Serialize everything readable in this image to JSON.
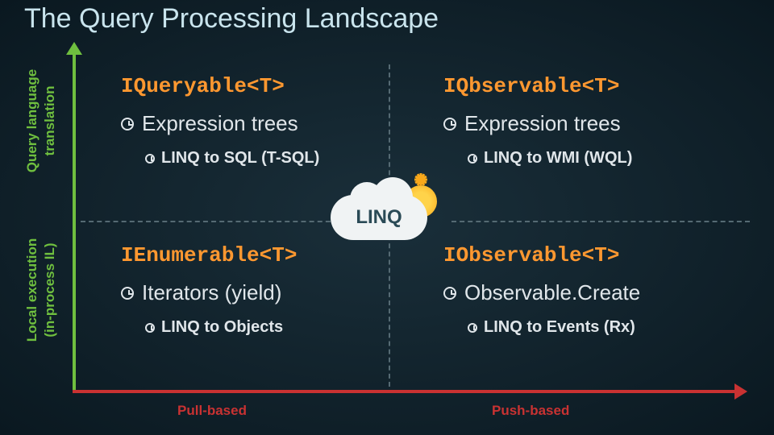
{
  "title": "The Query Processing Landscape",
  "axes": {
    "y": {
      "top": "Query language",
      "top2": "translation",
      "bottom": "Local execution",
      "bottom2": "(in-process IL)"
    },
    "x": {
      "left": "Pull-based",
      "right": "Push-based"
    }
  },
  "quadrants": {
    "tl": {
      "iface": "IQueryable<T>",
      "main": "Expression trees",
      "sub": "LINQ to SQL (T-SQL)"
    },
    "tr": {
      "iface": "IQbservable<T>",
      "main": "Expression trees",
      "sub": "LINQ to WMI (WQL)"
    },
    "bl": {
      "iface": "IEnumerable<T>",
      "main": "Iterators (yield)",
      "sub": "LINQ to Objects"
    },
    "br": {
      "iface": "IObservable<T>",
      "main": "Observable.Create",
      "sub": "LINQ to Events (Rx)"
    }
  },
  "center": "LINQ"
}
